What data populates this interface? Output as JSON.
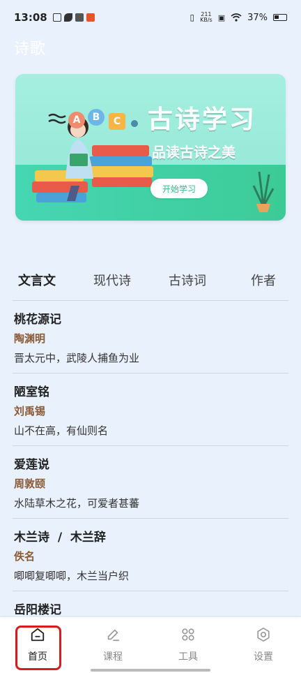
{
  "status_bar": {
    "time": "13:08",
    "speed_value": "211",
    "speed_unit": "KB/s",
    "battery": "37%"
  },
  "page": {
    "title": "诗歌"
  },
  "banner": {
    "title": "古诗学习",
    "subtitle": "品读古诗之美",
    "button": "开始学习",
    "letters": [
      "A",
      "B",
      "C"
    ],
    "colors": {
      "bg_top": "#a5efe0",
      "strip": "#47d6b3",
      "button_text": "#2fbf8f"
    }
  },
  "tabs": [
    {
      "label": "文言文",
      "active": true
    },
    {
      "label": "现代诗",
      "active": false
    },
    {
      "label": "古诗词",
      "active": false
    },
    {
      "label": "作者",
      "active": false
    }
  ],
  "items": [
    {
      "title": "桃花源记",
      "author": "陶渊明",
      "line": "晋太元中，武陵人捕鱼为业"
    },
    {
      "title": "陋室铭",
      "author": "刘禹锡",
      "line": "山不在高，有仙则名"
    },
    {
      "title": "爱莲说",
      "author": "周敦颐",
      "line": "水陆草木之花，可爱者甚蕃"
    },
    {
      "title": "木兰诗  /  木兰辞",
      "author": "佚名",
      "line": "唧唧复唧唧，木兰当户织"
    },
    {
      "title": "岳阳楼记",
      "author": "",
      "line": ""
    }
  ],
  "bottom_nav": [
    {
      "label": "首页",
      "icon": "home-icon",
      "active": true
    },
    {
      "label": "课程",
      "icon": "edit-icon",
      "active": false
    },
    {
      "label": "工具",
      "icon": "apps-icon",
      "active": false
    },
    {
      "label": "设置",
      "icon": "settings-icon",
      "active": false
    }
  ],
  "colors": {
    "author": "#8a5a36",
    "highlight": "#d61c1c",
    "page_bg": "#e9f1fc"
  }
}
